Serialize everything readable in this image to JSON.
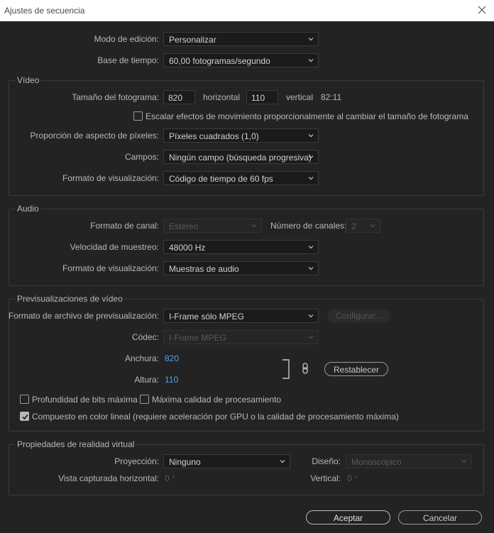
{
  "window": {
    "title": "Ajustes de secuencia"
  },
  "top": {
    "edit_mode_label": "Modo de edición:",
    "edit_mode_value": "Personalizar",
    "timebase_label": "Base de tiempo:",
    "timebase_value": "60,00  fotogramas/segundo"
  },
  "video": {
    "group_title": "Vídeo",
    "frame_size_label": "Tamaño del fotograma:",
    "frame_width": "820",
    "horizontal_label": "horizontal",
    "frame_height": "110",
    "vertical_label": "vertical",
    "aspect": "82:11",
    "scale_motion_label": "Escalar efectos de movimiento proporcionalmente al cambiar el tamaño de fotograma",
    "scale_motion_checked": false,
    "pixel_aspect_label": "Proporción de aspecto de píxeles:",
    "pixel_aspect_value": "Píxeles cuadrados (1,0)",
    "fields_label": "Campos:",
    "fields_value": "Ningún campo (búsqueda progresiva)",
    "display_format_label": "Formato de visualización:",
    "display_format_value": "Código de tiempo de 60 fps"
  },
  "audio": {
    "group_title": "Audio",
    "channel_format_label": "Formato de canal:",
    "channel_format_value": "Estéreo",
    "num_channels_label": "Número de canales:",
    "num_channels_value": "2",
    "sample_rate_label": "Velocidad de muestreo:",
    "sample_rate_value": "48000 Hz",
    "display_format_label": "Formato de visualización:",
    "display_format_value": "Muestras de audio"
  },
  "preview": {
    "group_title": "Previsualizaciones de vídeo",
    "file_format_label": "Formato de archivo de previsualización:",
    "file_format_value": "I-Frame sólo MPEG",
    "configure_label": "Configurar...",
    "codec_label": "Códec:",
    "codec_value": "I-Frame MPEG",
    "width_label": "Anchura:",
    "width_value": "820",
    "height_label": "Altura:",
    "height_value": "110",
    "reset_label": "Restablecer",
    "max_bit_depth_label": "Profundidad de bits máxima",
    "max_bit_depth_checked": false,
    "max_render_label": "Máxima calidad de procesamiento",
    "max_render_checked": false,
    "linear_color_label": "Compuesto en color lineal (requiere aceleración por GPU o la calidad de procesamiento máxima)",
    "linear_color_checked": true
  },
  "vr": {
    "group_title": "Propiedades de realidad virtual",
    "projection_label": "Proyección:",
    "projection_value": "Ninguno",
    "layout_label": "Diseño:",
    "layout_value": "Monoscópico",
    "h_view_label": "Vista capturada horizontal:",
    "h_view_value": "0 °",
    "vertical_label": "Vertical:",
    "vertical_value": "0 °"
  },
  "footer": {
    "ok_label": "Aceptar",
    "cancel_label": "Cancelar"
  },
  "colors": {
    "background": "#232323",
    "link_blue": "#4ea1e8",
    "titlebar": "#ffffff"
  },
  "icons": {
    "close": "close-icon",
    "dropdown": "chevron-down-icon",
    "link": "chain-link-icon",
    "check": "check-icon"
  }
}
